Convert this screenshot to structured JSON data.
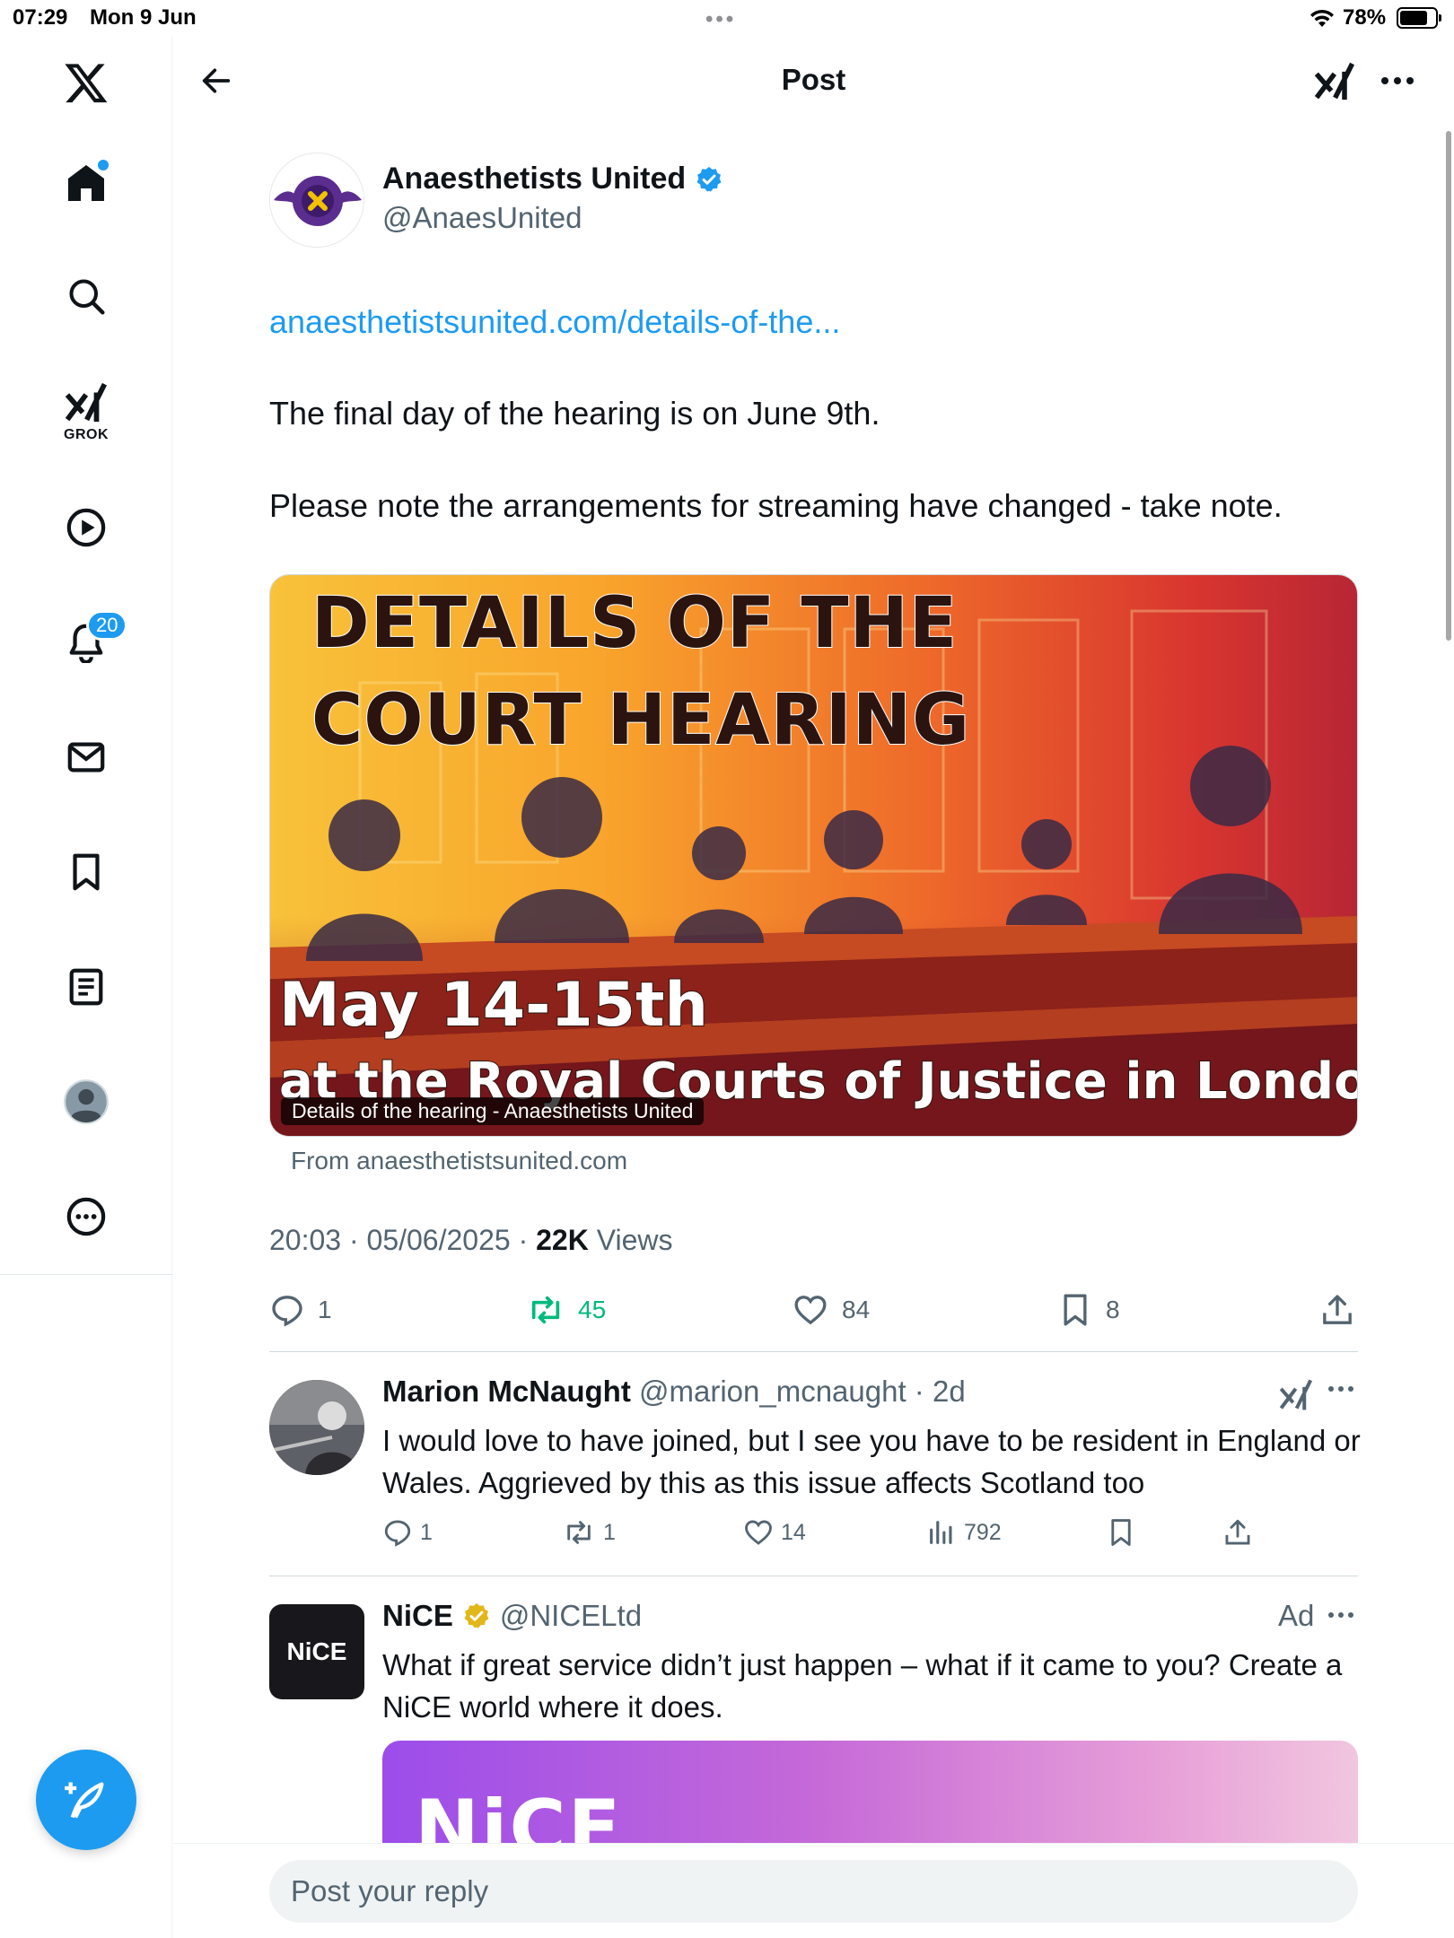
{
  "status_bar": {
    "time": "07:29",
    "date": "Mon 9 Jun",
    "battery": "78%",
    "battery_level": 0.78
  },
  "sidebar": {
    "items": [
      {
        "name": "x-logo-icon"
      },
      {
        "name": "home-icon",
        "has_dot": true
      },
      {
        "name": "search-icon"
      },
      {
        "name": "grok-icon",
        "label": "GROK"
      },
      {
        "name": "video-icon"
      },
      {
        "name": "notifications-icon",
        "badge": "20"
      },
      {
        "name": "messages-icon"
      },
      {
        "name": "bookmarks-icon"
      },
      {
        "name": "lists-icon"
      },
      {
        "name": "profile-icon"
      },
      {
        "name": "more-icon"
      }
    ],
    "compose_icon": "compose-feather-icon"
  },
  "header": {
    "title": "Post"
  },
  "post": {
    "author_name": "Anaesthetists United",
    "author_handle": "@AnaesUnited",
    "verified_color": "#1d9bf0",
    "link": "anaesthetistsunited.com/details-of-the...",
    "text_line1": "The final day of the hearing is on June 9th.",
    "text_line2": "Please note the arrangements for streaming have changed - take note.",
    "card": {
      "headline_line1": "DETAILS OF THE",
      "headline_line2": "COURT HEARING",
      "date_text": "May 14-15th",
      "venue_text": "at the Royal Courts of Justice in London",
      "caption": "Details of the hearing - Anaesthetists United",
      "from": "From anaesthetistsunited.com"
    },
    "meta_time": "20:03 · 05/06/2025 · ",
    "views_count": "22K",
    "views_label": " Views",
    "stats": {
      "replies": "1",
      "reposts": "45",
      "likes": "84",
      "bookmarks": "8"
    }
  },
  "reply": {
    "name": "Marion McNaught",
    "handle_time": " @marion_mcnaught · 2d",
    "text": "I would love to have joined, but I see you have to be resident in England or Wales. Aggrieved by this as this issue affects Scotland too",
    "stats": {
      "replies": "1",
      "reposts": "1",
      "likes": "14",
      "views": "792"
    }
  },
  "ad": {
    "name": "NiCE",
    "handle": "@NICELtd",
    "label": "Ad",
    "avatar_text": "NiCE",
    "text": "What if great service didn’t just happen – what if it came to you? Create a NiCE world where it does.",
    "banner_text": "NiCE",
    "verified_color": "#e2b719"
  },
  "reply_bar": {
    "placeholder": "Post your reply"
  },
  "colors": {
    "accent": "#1d9bf0",
    "repost": "#00ba7c",
    "muted": "#536471"
  }
}
